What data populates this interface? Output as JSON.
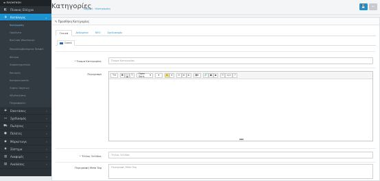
{
  "sidebar": {
    "brand": "≡ ΠΛΟΗΓΗΣΗ",
    "items": [
      {
        "label": "Πίνακας Ελέγχου",
        "icon": "dashboard-icon",
        "glyph": "◧"
      },
      {
        "label": "Κατάλογος",
        "icon": "tag-icon",
        "glyph": "⬗"
      }
    ],
    "subitems": [
      {
        "label": "Κατηγορίες"
      },
      {
        "label": "Προϊόντα"
      },
      {
        "label": "BarCode Warehouse"
      },
      {
        "label": "Επαναλαμβανόμενα Προφίλ"
      },
      {
        "label": "Φίλτρα"
      },
      {
        "label": "Χαρακτηριστικά"
      },
      {
        "label": "Επιλογές"
      },
      {
        "label": "Κατασκευαστές"
      },
      {
        "label": "Λήψεις Αρχείων"
      },
      {
        "label": "Αξιολογήσεις"
      },
      {
        "label": "Πληροφορίες"
      }
    ],
    "bottom_items": [
      {
        "label": "Επεκτάσεις",
        "icon": "puzzle-icon",
        "glyph": "✚"
      },
      {
        "label": "Σχεδιασμός",
        "icon": "monitor-icon",
        "glyph": "▭"
      },
      {
        "label": "Πωλήσεις",
        "icon": "cart-icon",
        "glyph": "⛟"
      },
      {
        "label": "Πελάτες",
        "icon": "user-icon",
        "glyph": "●"
      },
      {
        "label": "Μάρκετινγκ",
        "icon": "share-icon",
        "glyph": "◆"
      },
      {
        "label": "Σύστημα",
        "icon": "cog-icon",
        "glyph": "✹"
      },
      {
        "label": "Αναφορές",
        "icon": "chart-icon",
        "glyph": "▥"
      },
      {
        "label": "Αναλύσεις",
        "icon": "analytics-icon",
        "glyph": "▤"
      }
    ]
  },
  "header": {
    "title": "Κατηγορίες",
    "breadcrumb_home": "Αρχική",
    "breadcrumb_sep": "›",
    "breadcrumb_current": "Κατηγορίες",
    "save_icon": "💾",
    "back_icon": "↩"
  },
  "panel": {
    "title": "✎ Προσθήκη Κατηγορίας",
    "tabs": [
      "Γενικά",
      "Δεδομένα",
      "SEO",
      "Σχεδιασμός"
    ],
    "language_tab": "Greek"
  },
  "form": {
    "name_label": "Όνομα Κατηγορίας",
    "name_placeholder": "Όνομα Κατηγορίας",
    "desc_label": "Περιγραφή",
    "meta_title_label": "Τίτλος Σελίδας",
    "meta_title_placeholder": "Τίτλος Σελίδας",
    "meta_desc_label": "Περιγραφή Meta Tag",
    "meta_desc_placeholder": "Περιγραφή Meta Tag",
    "required_mark": "*"
  },
  "editor": {
    "font_name": "Open Sans",
    "toolbar": [
      "✎",
      "B",
      "U",
      "T",
      "A",
      "≔",
      "≡",
      "≣",
      "▦",
      "🔗",
      "▣",
      "▶",
      "⤧",
      "</>",
      "?"
    ]
  }
}
